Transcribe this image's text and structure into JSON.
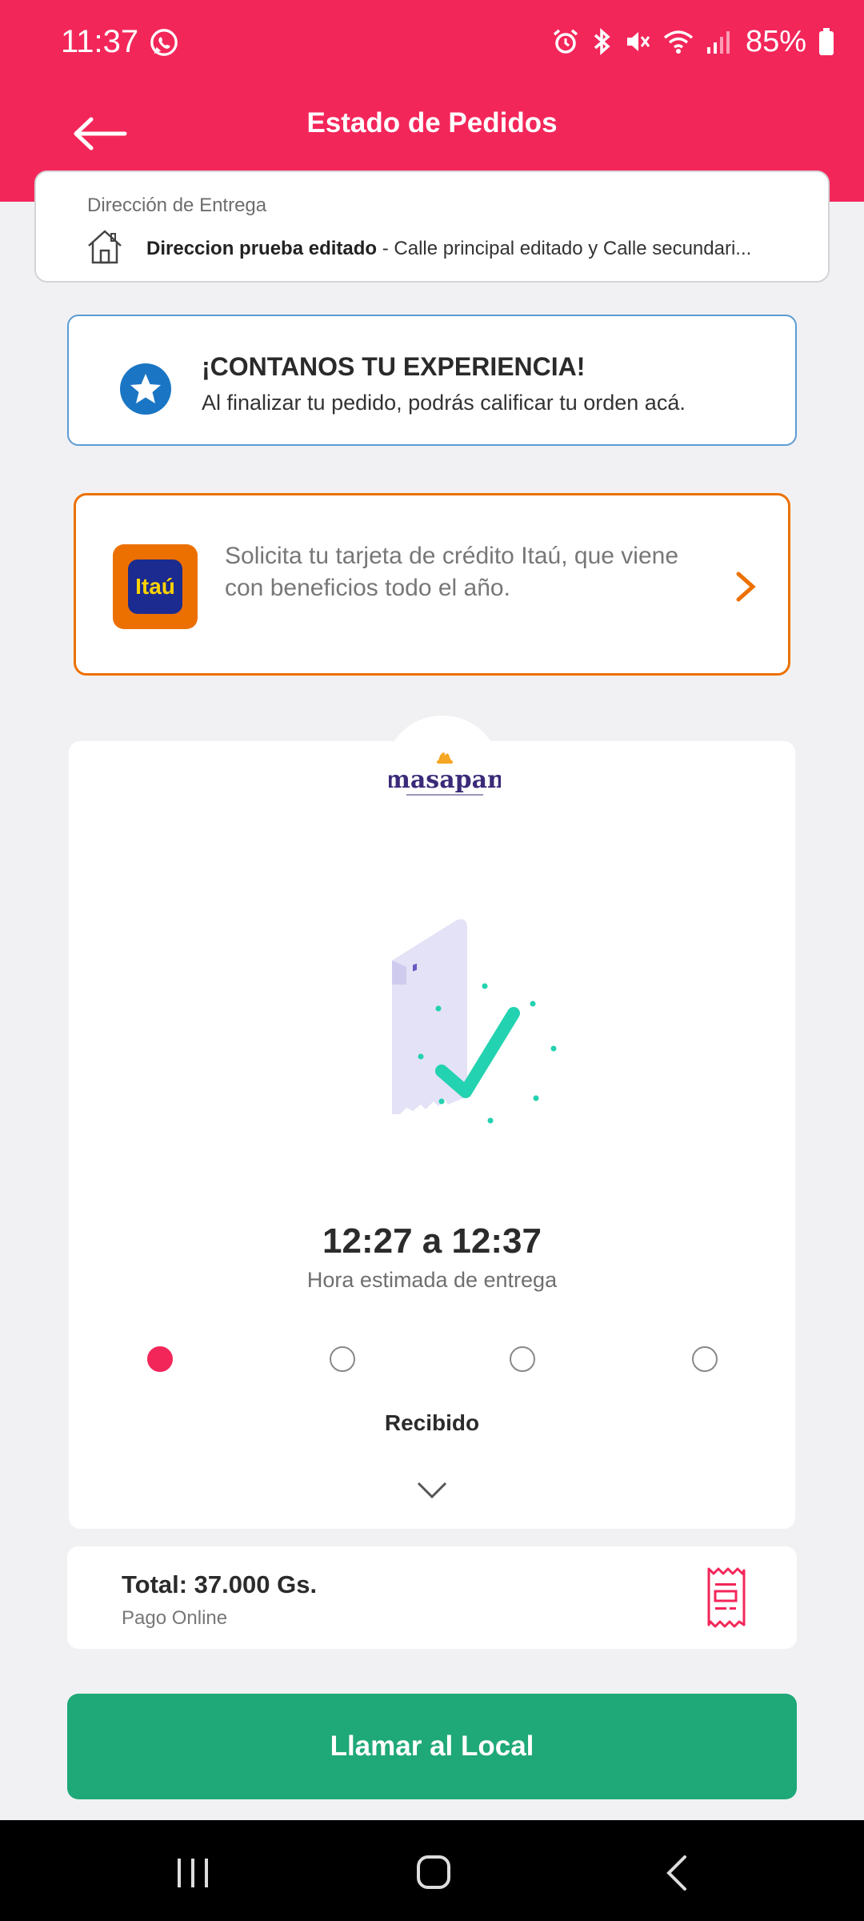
{
  "status_bar": {
    "time": "11:37",
    "battery": "85%"
  },
  "header": {
    "title": "Estado de Pedidos"
  },
  "address": {
    "label": "Dirección de Entrega",
    "name": "Direccion prueba editado",
    "detail": " - Calle principal editado y Calle secundari..."
  },
  "experience": {
    "title": "¡CONTANOS TU EXPERIENCIA!",
    "text": "Al finalizar tu pedido, podrás calificar tu orden acá."
  },
  "promo": {
    "logo_text": "Itaú",
    "text": "Solicita tu tarjeta de crédito Itaú, que viene con beneficios todo el año."
  },
  "order": {
    "brand": "masapan",
    "eta": "12:27 a 12:37",
    "eta_label": "Hora estimada de entrega",
    "current_step_label": "Recibido",
    "steps_total": 4,
    "current_step": 1
  },
  "summary": {
    "total": "Total: 37.000 Gs.",
    "payment": "Pago Online"
  },
  "actions": {
    "call_label": "Llamar al Local"
  },
  "colors": {
    "brand_pink": "#f3265a",
    "call_green": "#1fa878",
    "itau_orange": "#ec7000",
    "info_blue": "#5b9bd5"
  },
  "icons": [
    "whatsapp-icon",
    "alarm-icon",
    "bluetooth-icon",
    "mute-icon",
    "wifi-icon",
    "signal-icon",
    "battery-icon",
    "back-arrow-icon",
    "house-icon",
    "star-icon",
    "itau-logo",
    "chevron-right-icon",
    "receipt-check-illustration",
    "chevron-down-icon",
    "receipt-icon"
  ]
}
